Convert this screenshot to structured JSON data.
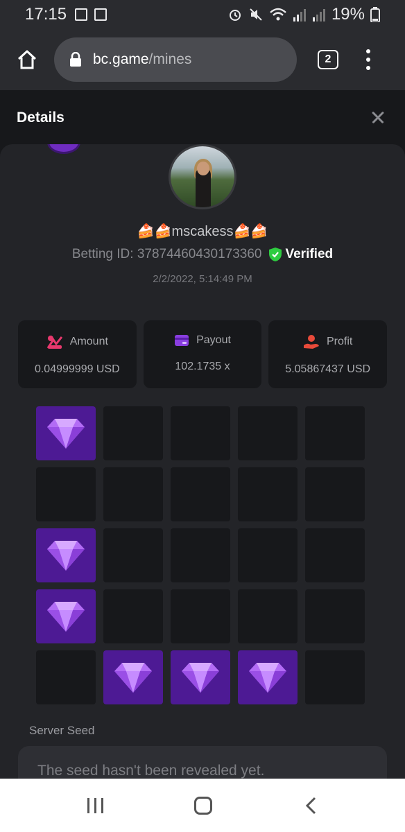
{
  "status_bar": {
    "time": "17:15",
    "battery": "19%"
  },
  "browser": {
    "url_domain": "bc.game",
    "url_path": "/mines",
    "tab_count": "2"
  },
  "details": {
    "title": "Details"
  },
  "bet": {
    "username": "🍰🍰mscakess🍰🍰",
    "betting_id_label": "Betting ID: 37874460430173360",
    "verified_label": "Verified",
    "datetime": "2/2/2022, 5:14:49 PM"
  },
  "stats": [
    {
      "label": "Amount",
      "value": "0.04999999 USD",
      "icon": "amount-icon",
      "color": "#e8386d"
    },
    {
      "label": "Payout",
      "value": "102.1735 x",
      "icon": "payout-icon",
      "color": "#8a3ee0"
    },
    {
      "label": "Profit",
      "value": "5.05867437 USD",
      "icon": "profit-icon",
      "color": "#e84a3a"
    }
  ],
  "board": {
    "rows": 5,
    "cols": 5,
    "gems": [
      [
        0,
        0
      ],
      [
        2,
        0
      ],
      [
        3,
        0
      ],
      [
        4,
        1
      ],
      [
        4,
        2
      ],
      [
        4,
        3
      ]
    ],
    "gem_color": "#4d1a94"
  },
  "server_seed": {
    "label": "Server Seed",
    "value": "The seed hasn't been revealed yet."
  },
  "colors": {
    "verified_green": "#2ecc40",
    "panel": "#232428",
    "background": "#17181b"
  }
}
